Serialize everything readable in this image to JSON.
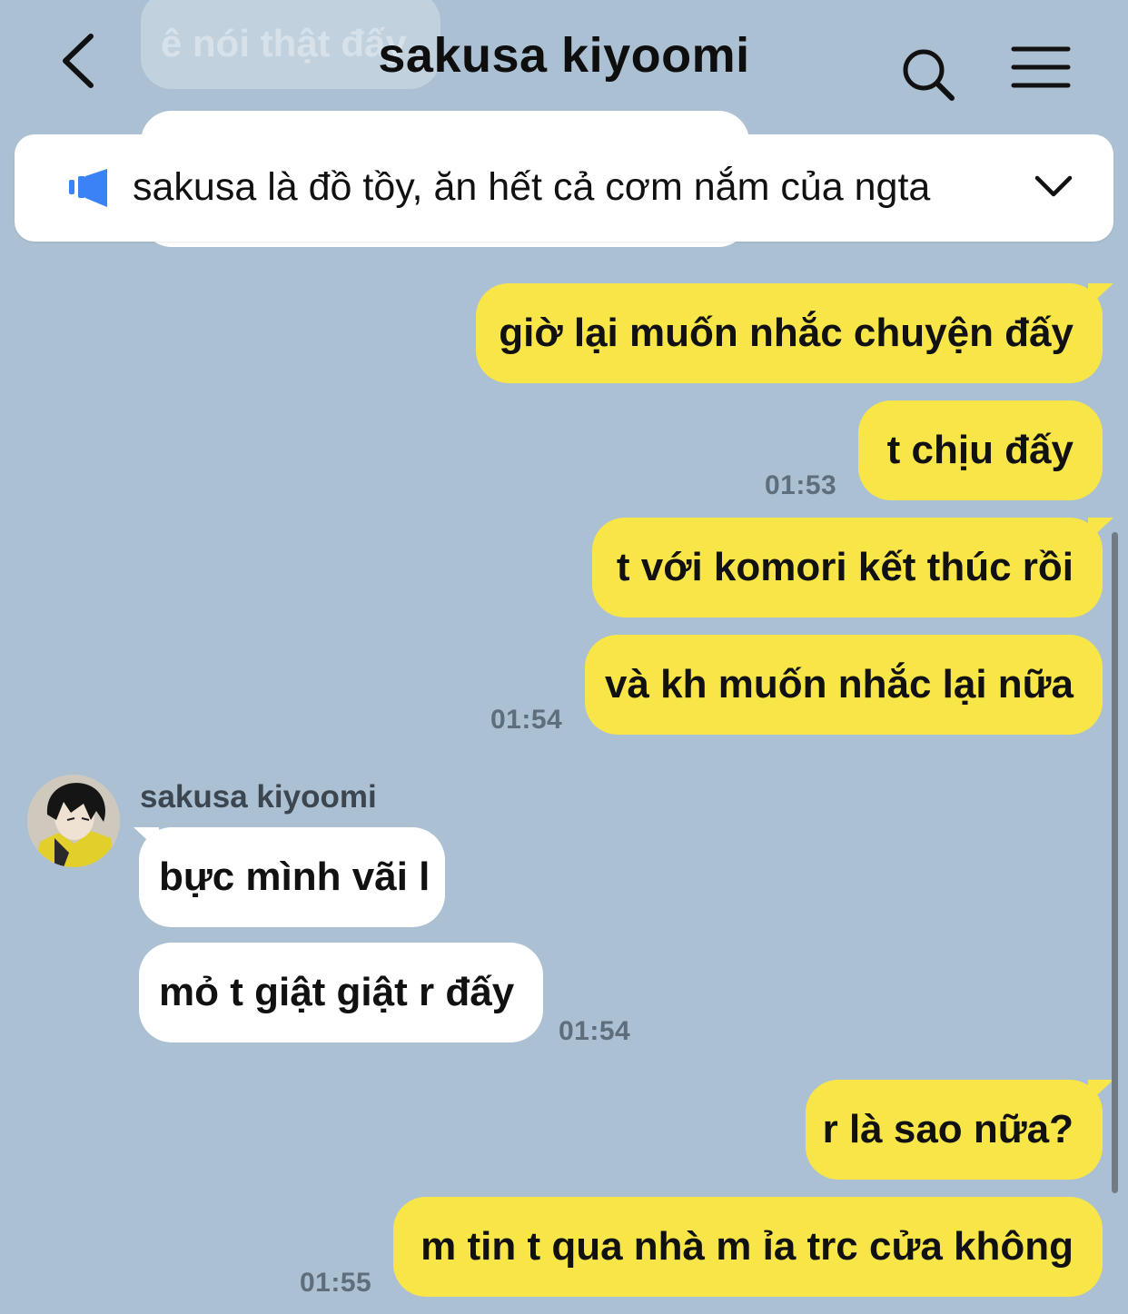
{
  "header": {
    "title": "sakusa kiyoomi"
  },
  "ghost": {
    "top_message": "ê nói thật đấy"
  },
  "notice": {
    "text": "sakusa là đồ tồy, ăn hết cả cơm nắm của ngta"
  },
  "messages": [
    {
      "text": "giờ lại muốn nhắc chuyện đấy"
    },
    {
      "text": "t chịu đấy",
      "time": "01:53"
    },
    {
      "text": "t với komori kết thúc rồi"
    },
    {
      "text": "và kh muốn nhắc lại nữa",
      "time": "01:54"
    },
    {
      "text": "bực mình vãi l",
      "sender": "sakusa kiyoomi"
    },
    {
      "text": "mỏ t giật giật r đấy",
      "time": "01:54"
    },
    {
      "text": "r là sao nữa?"
    },
    {
      "text": "m tin t qua nhà m ỉa trc cửa không",
      "time": "01:55"
    }
  ],
  "colors": {
    "background": "#abc0d2",
    "outgoing_bubble": "#f8e649",
    "incoming_bubble": "#ffffff",
    "notice_icon": "#3b82f6"
  },
  "icons": [
    "back-arrow-icon",
    "search-icon",
    "menu-icon",
    "megaphone-icon",
    "chevron-down-icon"
  ]
}
